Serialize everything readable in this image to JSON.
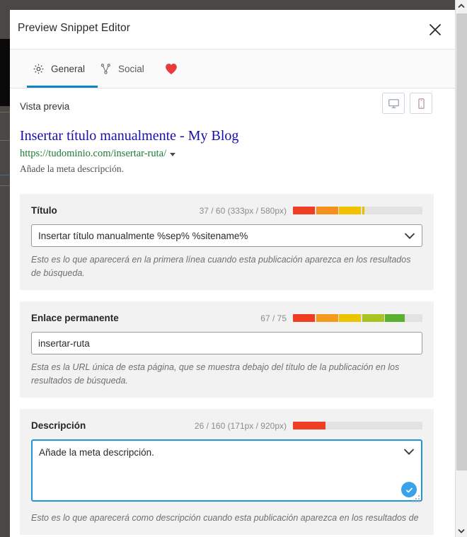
{
  "window": {
    "title": "Preview Snippet Editor",
    "close_icon": "close-icon"
  },
  "tabs": [
    {
      "label": "General",
      "icon": "gear-icon",
      "active": true
    },
    {
      "label": "Social",
      "icon": "share-nodes-icon",
      "active": false
    },
    {
      "label": "",
      "icon": "heart-icon",
      "active": false
    }
  ],
  "preview": {
    "label": "Vista previa",
    "device_buttons": [
      {
        "icon": "desktop-icon",
        "name": "desktop-preview-button"
      },
      {
        "icon": "mobile-icon",
        "name": "mobile-preview-button"
      }
    ],
    "snippet": {
      "title": "Insertar título manualmente - My Blog",
      "url": "https://tudominio.com/insertar-ruta/",
      "description": "Añade la meta descripción."
    }
  },
  "fields": {
    "title": {
      "label": "Título",
      "counter": "37 / 60 (333px / 580px)",
      "value": "Insertar título manualmente %sep% %sitename%",
      "help": "Esto es lo que aparecerá en la primera línea cuando esta publicación aparezca en los resultados de búsqueda.",
      "progress": {
        "segments": [
          {
            "width": 17,
            "color": "#ef3e23"
          },
          {
            "width": 17,
            "color": "#f4901e"
          },
          {
            "width": 17,
            "color": "#f2c200"
          },
          {
            "width": 1.5,
            "color": "#e0c000"
          }
        ],
        "track_color": "#e2e2e2"
      }
    },
    "permalink": {
      "label": "Enlace permanente",
      "counter": "67 / 75",
      "value": "insertar-ruta",
      "help": "Esta es la URL única de esta página, que se muestra debajo del título de la publicación en los resultados de búsqueda.",
      "progress": {
        "segments": [
          {
            "width": 17,
            "color": "#ee3d23"
          },
          {
            "width": 17,
            "color": "#f49a1c"
          },
          {
            "width": 17,
            "color": "#ecc400"
          },
          {
            "width": 17,
            "color": "#a9c322"
          },
          {
            "width": 15,
            "color": "#5bb030"
          }
        ],
        "track_color": "#e2e2e2"
      }
    },
    "description": {
      "label": "Descripción",
      "counter": "26 / 160 (171px / 920px)",
      "value": "Añade la meta descripción.",
      "help": "Esto es lo que aparecerá como descripción cuando esta publicación aparezca en los resultados de",
      "focused": true,
      "check_badge": "check-icon",
      "progress": {
        "segments": [
          {
            "width": 25,
            "color": "#ef3e23"
          }
        ],
        "track_color": "#e2e2e2"
      }
    }
  },
  "scrollbar": {
    "up_icon": "chevron-up-icon",
    "down_icon": "chevron-down-icon"
  },
  "colors": {
    "accent": "#0d86c8",
    "focus_border": "#1e96d8",
    "link": "#1a0dab",
    "url_green": "#1a7a33",
    "badge_blue": "#38a3e8",
    "heart_red": "#e83b3b"
  }
}
